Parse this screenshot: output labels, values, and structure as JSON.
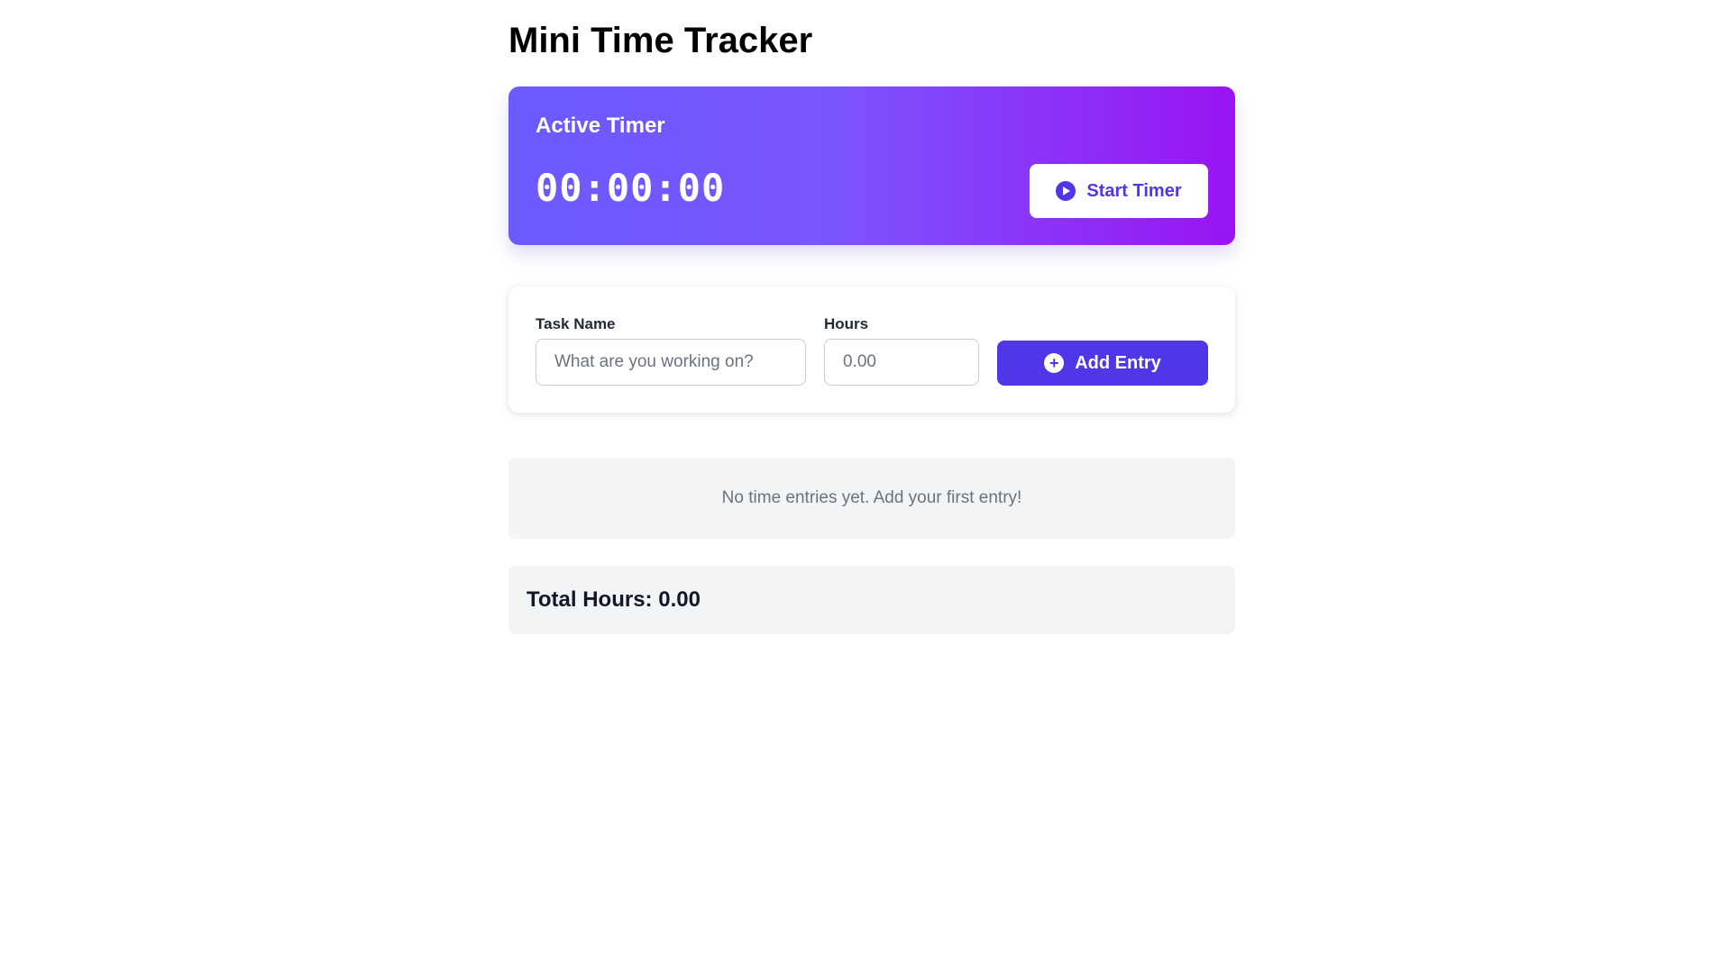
{
  "app": {
    "title": "Mini Time Tracker"
  },
  "timer": {
    "heading": "Active Timer",
    "display": "00:00:00",
    "start_label": "Start Timer",
    "start_icon": "play-circle-icon"
  },
  "entry_form": {
    "task_label": "Task Name",
    "task_placeholder": "What are you working on?",
    "task_value": "",
    "hours_label": "Hours",
    "hours_placeholder": "0.00",
    "hours_value": "",
    "add_label": "Add Entry",
    "add_icon": "plus-circle-icon"
  },
  "entries": {
    "empty_message": "No time entries yet. Add your first entry!"
  },
  "summary": {
    "total_text": "Total Hours: 0.00"
  },
  "colors": {
    "accent": "#4f36e6",
    "gradient_start": "#6a5bfd",
    "gradient_end": "#9a14f4",
    "muted_bg": "#f3f4f6"
  }
}
